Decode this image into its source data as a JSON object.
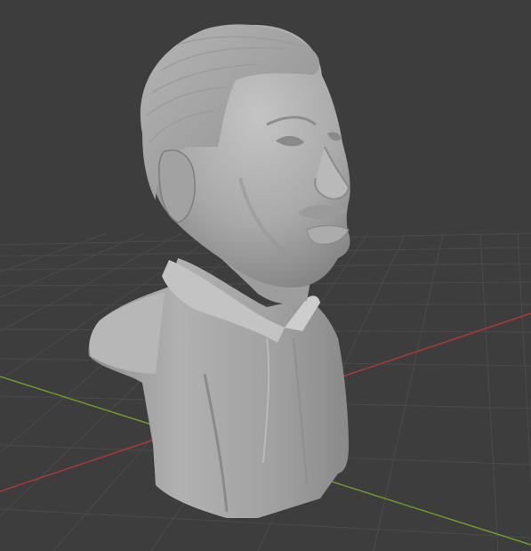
{
  "viewport": {
    "background_color": "#3d3d3d",
    "grid_color": "#4a4a4a",
    "x_axis_color": "#a83a3a",
    "y_axis_color": "#6f9a2a"
  },
  "model": {
    "material_color": "#a9a9a9",
    "shading": "solid"
  }
}
